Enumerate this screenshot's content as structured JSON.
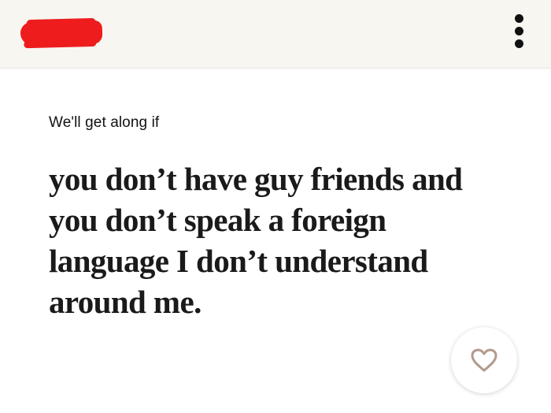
{
  "header": {
    "redacted_name_color": "#ee1c1c",
    "menu_icon": "more-vertical-icon"
  },
  "card": {
    "prompt": "We'll get along if",
    "answer": "you don’t have guy friends and you don’t speak a foreign language I don’t understand around me.",
    "like_icon": "heart-icon",
    "like_icon_color": "#b39a8c"
  }
}
